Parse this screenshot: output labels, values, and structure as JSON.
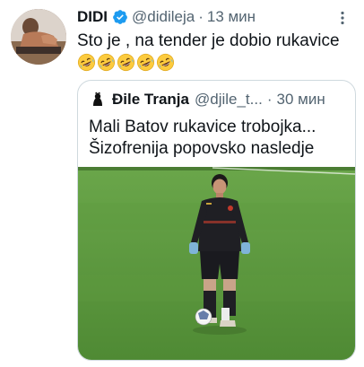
{
  "tweet": {
    "author_name": "DIDI",
    "author_handle": "@didileja",
    "separator": "·",
    "time": "13 мин",
    "text": "Sto je , na tender je dobio rukavice",
    "emojis": [
      "rolling-on-floor-laughing-emoji",
      "rolling-on-floor-laughing-emoji",
      "rolling-on-floor-laughing-emoji",
      "rolling-on-floor-laughing-emoji",
      "rolling-on-floor-laughing-emoji"
    ]
  },
  "quote": {
    "author_name": "Đile Tranja",
    "author_handle": "@djile_t...",
    "separator": "·",
    "time": "30 мин",
    "text_lines": [
      "Mali Batov rukavice trobojka...",
      "Šizofrenija popovsko nasledje"
    ],
    "media": {
      "description_icon": "football-player-photo",
      "colors": {
        "pitch": "#5f9b3f",
        "pitch_dark": "#4e8733",
        "kit": "#1f1f24",
        "gloves": "#7fb4d8"
      }
    }
  },
  "colors": {
    "verified": "#1d9bf0",
    "secondary_text": "#536471",
    "border": "#cfd9de"
  }
}
